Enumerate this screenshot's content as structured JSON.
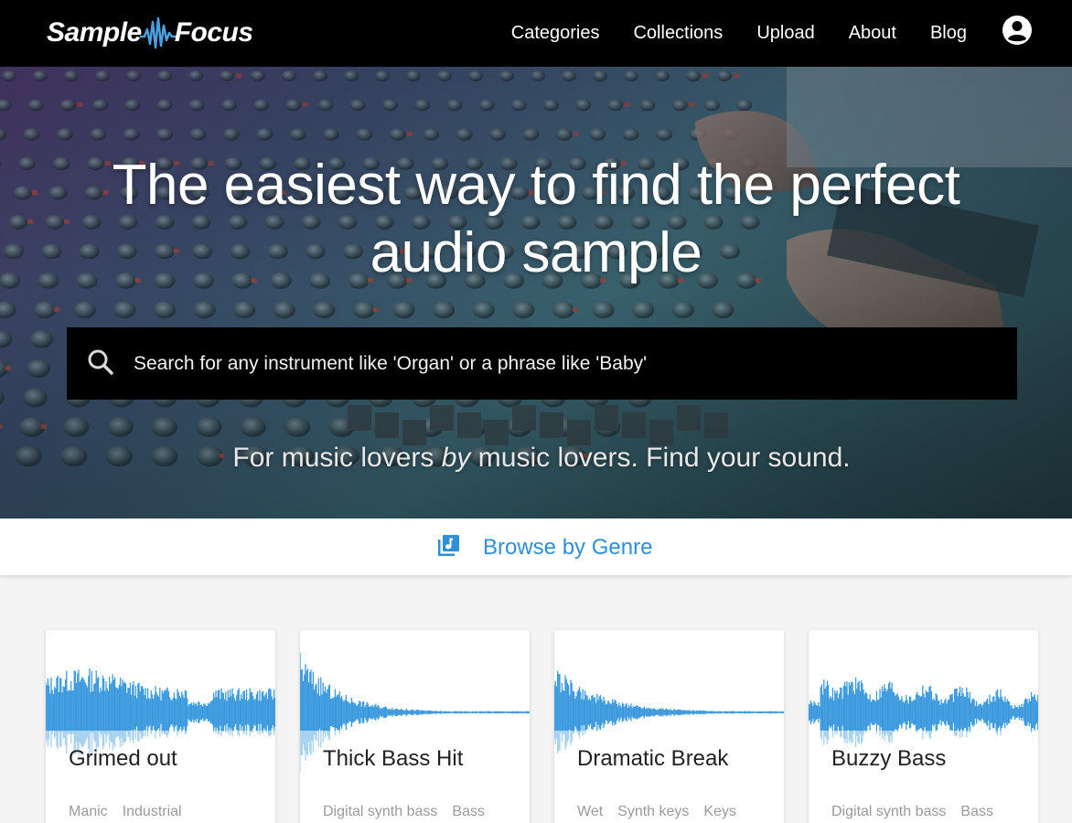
{
  "brand": {
    "part1": "Sample",
    "part2": "Focus"
  },
  "nav": {
    "items": [
      {
        "label": "Categories"
      },
      {
        "label": "Collections"
      },
      {
        "label": "Upload"
      },
      {
        "label": "About"
      },
      {
        "label": "Blog"
      }
    ],
    "account_icon": "account-circle-icon"
  },
  "hero": {
    "title": "The easiest way to find the perfect audio sample",
    "search": {
      "placeholder": "Search for any instrument like 'Organ' or a phrase like 'Baby'",
      "value": "",
      "icon": "search-icon"
    },
    "tagline": {
      "before": "For music lovers ",
      "emphasis": "by",
      "after": " music lovers. Find your sound."
    }
  },
  "browse": {
    "label": "Browse by Genre",
    "icon": "library-music-icon"
  },
  "cards": [
    {
      "title": "Grimed out",
      "tags": [
        "Manic",
        "Industrial"
      ]
    },
    {
      "title": "Thick Bass Hit",
      "tags": [
        "Digital synth bass",
        "Bass"
      ]
    },
    {
      "title": "Dramatic Break",
      "tags": [
        "Wet",
        "Synth keys",
        "Keys"
      ]
    },
    {
      "title": "Buzzy Bass",
      "tags": [
        "Digital synth bass",
        "Bass"
      ]
    }
  ],
  "colors": {
    "accent": "#2f8fd8",
    "waveform": "#3b99dd",
    "nav_bg": "#000000"
  }
}
